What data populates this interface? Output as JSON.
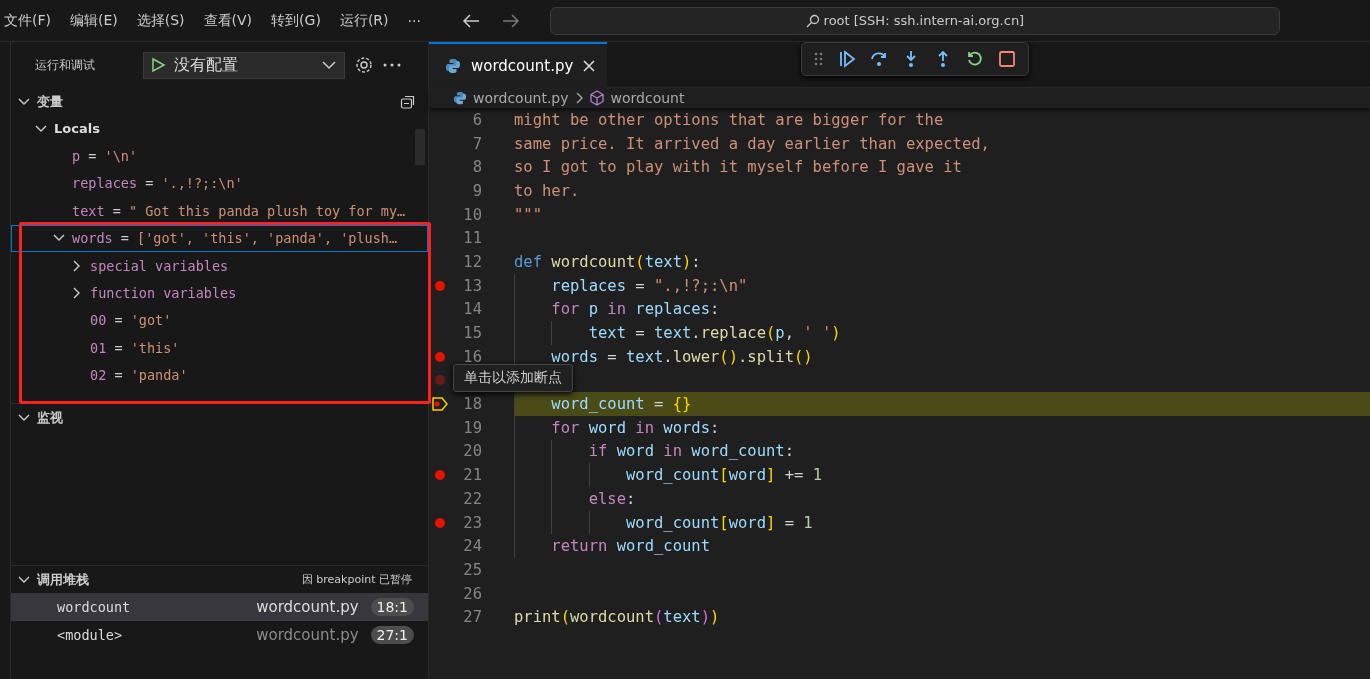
{
  "menu": [
    "文件(F)",
    "编辑(E)",
    "选择(S)",
    "查看(V)",
    "转到(G)",
    "运行(R)",
    "···"
  ],
  "command_center": {
    "text": "root [SSH: ssh.intern-ai.org.cn]"
  },
  "debug_panel": {
    "title": "运行和调试",
    "config": "没有配置"
  },
  "variables": {
    "title": "变量",
    "expanded": true,
    "tree": [
      {
        "name": "Locals",
        "expanded": true,
        "kind": "scope",
        "children": [
          {
            "name": "p",
            "sep": "=",
            "value": "'\\n'",
            "kind": "var"
          },
          {
            "name": "replaces",
            "sep": "=",
            "value": "'.,!?;:\\n'",
            "kind": "var"
          },
          {
            "name": "text",
            "sep": "=",
            "value": "\" Got this panda plush toy for my…",
            "kind": "var"
          },
          {
            "name": "words",
            "sep": "=",
            "value": "['got', 'this', 'panda', 'plush…",
            "kind": "var",
            "expanded": true,
            "selected": true,
            "children": [
              {
                "name": "special variables",
                "kind": "group",
                "expanded": false
              },
              {
                "name": "function variables",
                "kind": "group",
                "expanded": false
              },
              {
                "name": "00",
                "sep": "=",
                "value": "'got'",
                "kind": "var"
              },
              {
                "name": "01",
                "sep": "=",
                "value": "'this'",
                "kind": "var"
              },
              {
                "name": "02",
                "sep": "=",
                "value": "'panda'",
                "kind": "var"
              }
            ]
          }
        ]
      }
    ]
  },
  "watch": {
    "title": "监视",
    "expanded": true
  },
  "call_stack": {
    "title": "调用堆栈",
    "status": "因 breakpoint 已暂停",
    "frames": [
      {
        "name": "wordcount",
        "file": "wordcount.py",
        "pos": "18:1",
        "selected": true
      },
      {
        "name": "<module>",
        "file": "wordcount.py",
        "pos": "27:1",
        "selected": false
      }
    ]
  },
  "tab": {
    "label": "wordcount.py",
    "selected": true
  },
  "breadcrumb": [
    "wordcount.py",
    "wordcount"
  ],
  "tooltip": "单击以添加断点",
  "code": [
    {
      "number": "6",
      "kind": "plain",
      "tokens": [
        {
          "t": "might be other options that are bigger for the",
          "kind": "str"
        }
      ]
    },
    {
      "number": "7",
      "kind": "plain",
      "tokens": [
        {
          "t": "same price. It arrived a day earlier than expected,",
          "kind": "str"
        }
      ]
    },
    {
      "number": "8",
      "kind": "plain",
      "tokens": [
        {
          "t": "so I got to play with it myself before I gave it",
          "kind": "str"
        }
      ]
    },
    {
      "number": "9",
      "kind": "plain",
      "tokens": [
        {
          "t": "to her.",
          "kind": "str"
        }
      ]
    },
    {
      "number": "10",
      "kind": "plain",
      "tokens": [
        {
          "t": "\"\"\"",
          "kind": "str"
        }
      ]
    },
    {
      "number": "11",
      "kind": "plain"
    },
    {
      "number": "12",
      "kind": "plain",
      "tokens": [
        {
          "t": "def ",
          "kind": "kw"
        },
        {
          "t": "wordcount",
          "kind": "fn"
        },
        {
          "t": "(",
          "kind": "b1"
        },
        {
          "t": "text",
          "kind": "var"
        },
        {
          "t": ")",
          "kind": "b1"
        },
        {
          "t": ":",
          "kind": "p"
        }
      ]
    },
    {
      "number": "13",
      "kind": "breakpoint",
      "tokens": [
        {
          "t": "    replaces",
          "kind": "var"
        },
        {
          "t": " = ",
          "kind": "p"
        },
        {
          "t": "\".,!?;:\\n\"",
          "kind": "str"
        }
      ]
    },
    {
      "number": "14",
      "kind": "plain",
      "tokens": [
        {
          "t": "    for",
          "kind": "ctl"
        },
        {
          "t": " p ",
          "kind": "var"
        },
        {
          "t": "in",
          "kind": "ctl"
        },
        {
          "t": " replaces",
          "kind": "var"
        },
        {
          "t": ":",
          "kind": "p"
        }
      ]
    },
    {
      "number": "15",
      "kind": "plain",
      "tokens": [
        {
          "t": "        text",
          "kind": "var"
        },
        {
          "t": " = ",
          "kind": "p"
        },
        {
          "t": "text",
          "kind": "var"
        },
        {
          "t": ".",
          "kind": "p"
        },
        {
          "t": "replace",
          "kind": "fn"
        },
        {
          "t": "(",
          "kind": "b1"
        },
        {
          "t": "p",
          "kind": "var"
        },
        {
          "t": ", ",
          "kind": "p"
        },
        {
          "t": "' '",
          "kind": "str"
        },
        {
          "t": ")",
          "kind": "b1"
        }
      ]
    },
    {
      "number": "16",
      "kind": "breakpoint",
      "tokens": [
        {
          "t": "    words",
          "kind": "var"
        },
        {
          "t": " = ",
          "kind": "p"
        },
        {
          "t": "text",
          "kind": "var"
        },
        {
          "t": ".",
          "kind": "p"
        },
        {
          "t": "lower",
          "kind": "fn"
        },
        {
          "t": "()",
          "kind": "b1"
        },
        {
          "t": ".",
          "kind": "p"
        },
        {
          "t": "split",
          "kind": "fn"
        },
        {
          "t": "()",
          "kind": "b1"
        }
      ]
    },
    {
      "kind": "hint"
    },
    {
      "number": "18",
      "kind": "current",
      "tokens": [
        {
          "t": "    word_count",
          "kind": "var"
        },
        {
          "t": " = ",
          "kind": "p"
        },
        {
          "t": "{}",
          "kind": "b1"
        }
      ]
    },
    {
      "number": "19",
      "kind": "plain",
      "tokens": [
        {
          "t": "    for",
          "kind": "ctl"
        },
        {
          "t": " word ",
          "kind": "var"
        },
        {
          "t": "in",
          "kind": "ctl"
        },
        {
          "t": " words",
          "kind": "var"
        },
        {
          "t": ":",
          "kind": "p"
        }
      ]
    },
    {
      "number": "20",
      "kind": "plain",
      "tokens": [
        {
          "t": "        if",
          "kind": "ctl"
        },
        {
          "t": " word ",
          "kind": "var"
        },
        {
          "t": "in",
          "kind": "ctl"
        },
        {
          "t": " word_count",
          "kind": "var"
        },
        {
          "t": ":",
          "kind": "p"
        }
      ]
    },
    {
      "number": "21",
      "kind": "breakpoint",
      "tokens": [
        {
          "t": "            word_count",
          "kind": "var"
        },
        {
          "t": "[",
          "kind": "b1"
        },
        {
          "t": "word",
          "kind": "var"
        },
        {
          "t": "]",
          "kind": "b1"
        },
        {
          "t": " += ",
          "kind": "p"
        },
        {
          "t": "1",
          "kind": "num"
        }
      ]
    },
    {
      "number": "22",
      "kind": "plain",
      "tokens": [
        {
          "t": "        else",
          "kind": "ctl"
        },
        {
          "t": ":",
          "kind": "p"
        }
      ]
    },
    {
      "number": "23",
      "kind": "breakpoint",
      "tokens": [
        {
          "t": "            word_count",
          "kind": "var"
        },
        {
          "t": "[",
          "kind": "b1"
        },
        {
          "t": "word",
          "kind": "var"
        },
        {
          "t": "]",
          "kind": "b1"
        },
        {
          "t": " = ",
          "kind": "p"
        },
        {
          "t": "1",
          "kind": "num"
        }
      ]
    },
    {
      "number": "24",
      "kind": "plain",
      "tokens": [
        {
          "t": "    return",
          "kind": "ctl"
        },
        {
          "t": " word_count",
          "kind": "var"
        }
      ]
    },
    {
      "number": "25",
      "kind": "plain"
    },
    {
      "number": "26",
      "kind": "plain"
    },
    {
      "number": "27",
      "kind": "plain",
      "tokens": [
        {
          "t": "print",
          "kind": "fn"
        },
        {
          "t": "(",
          "kind": "b1"
        },
        {
          "t": "wordcount",
          "kind": "fn"
        },
        {
          "t": "(",
          "kind": "b2"
        },
        {
          "t": "text",
          "kind": "var"
        },
        {
          "t": ")",
          "kind": "b2"
        },
        {
          "t": ")",
          "kind": "b1"
        }
      ]
    }
  ]
}
